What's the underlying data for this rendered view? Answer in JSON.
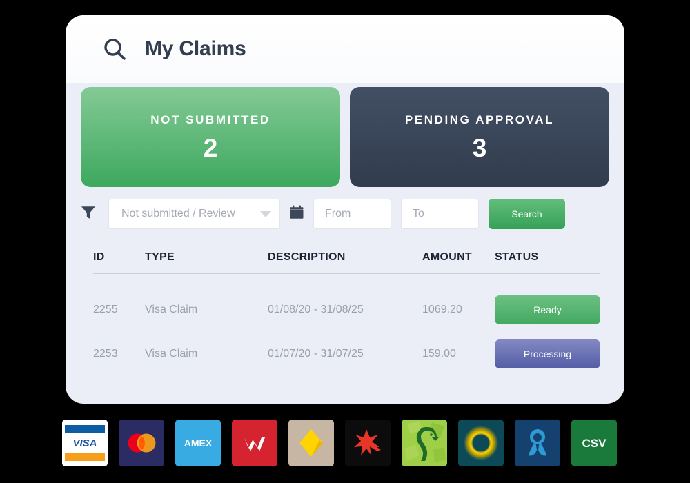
{
  "header": {
    "title": "My Claims",
    "search_icon": "search-icon"
  },
  "stats": [
    {
      "label": "NOT SUBMITTED",
      "value": "2",
      "theme": "green",
      "color": "#3da85e"
    },
    {
      "label": "PENDING APPROVAL",
      "value": "3",
      "theme": "dark",
      "color": "#313c4d"
    }
  ],
  "filters": {
    "filter_icon": "funnel-icon",
    "calendar_icon": "calendar-icon",
    "status_select": {
      "value": "Not submitted / Review",
      "options": [
        "Not submitted / Review"
      ]
    },
    "from": {
      "value": "",
      "placeholder": "From"
    },
    "to": {
      "value": "",
      "placeholder": "To"
    },
    "search_button": "Search"
  },
  "table": {
    "columns": [
      "ID",
      "TYPE",
      "DESCRIPTION",
      "AMOUNT",
      "STATUS"
    ],
    "rows": [
      {
        "id": "2255",
        "type": "Visa Claim",
        "description": "01/08/20 - 31/08/25",
        "amount": "1069.20",
        "status": "Ready",
        "status_theme": "ready"
      },
      {
        "id": "2253",
        "type": "Visa Claim",
        "description": "01/07/20 - 31/07/25",
        "amount": "159.00",
        "status": "Processing",
        "status_theme": "processing"
      }
    ]
  },
  "logos": [
    {
      "name": "visa-logo",
      "label": "VISA",
      "bg": "#ffffff"
    },
    {
      "name": "mastercard-logo",
      "label": "",
      "bg": "#2b2c64"
    },
    {
      "name": "amex-logo",
      "label": "AMEX",
      "bg": "#38ace2"
    },
    {
      "name": "westpac-logo",
      "label": "",
      "bg": "#d5232f"
    },
    {
      "name": "commbank-logo",
      "label": "",
      "bg": "#c6b6a3"
    },
    {
      "name": "nab-logo",
      "label": "",
      "bg": "#0c0c0c"
    },
    {
      "name": "stgeorge-logo",
      "label": "",
      "bg": "#97c93d"
    },
    {
      "name": "bankwest-logo",
      "label": "",
      "bg": "#0c4a58"
    },
    {
      "name": "anz-logo",
      "label": "",
      "bg": "#14416e"
    },
    {
      "name": "csv-logo",
      "label": "CSV",
      "bg": "#1a7a3c"
    }
  ],
  "colors": {
    "page_bg": "#000000",
    "card_bg": "#ebeef7",
    "header_bg": "#ffffff",
    "accent_green": "#3da85e",
    "accent_dark": "#333e50",
    "accent_purple": "#545da5",
    "muted_text": "#9aa0ad"
  }
}
